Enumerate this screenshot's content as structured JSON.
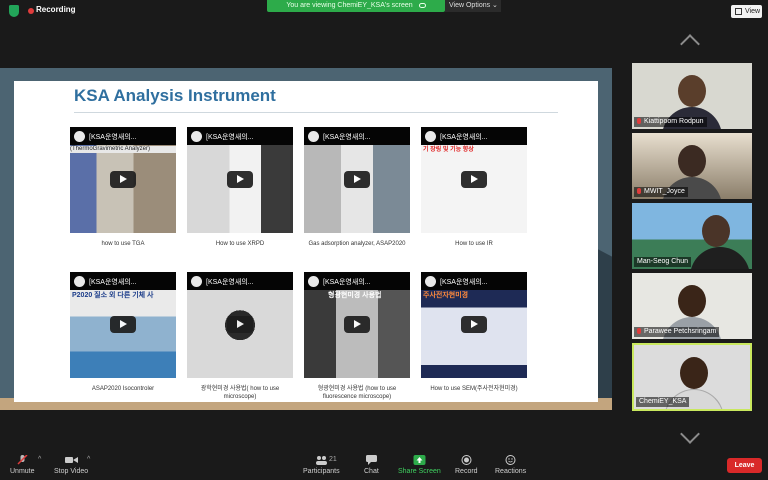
{
  "topbar": {
    "recording_label": "Recording",
    "viewing_banner": "You are viewing ChemiEY_KSA's screen",
    "view_options_label": "View Options ⌄",
    "view_button_label": "View"
  },
  "slide": {
    "title": "KSA Analysis Instrument",
    "videos": [
      {
        "thumb_title": "[KSA운영새의...",
        "overlay": "(ThermoGravimetric Analyzer)",
        "caption": "how to use TGA"
      },
      {
        "thumb_title": "[KSA운영새의...",
        "overlay": "",
        "caption": "How to use XRPD"
      },
      {
        "thumb_title": "[KSA운영새의...",
        "overlay": "",
        "caption": "Gas adsorption analyzer, ASAP2020"
      },
      {
        "thumb_title": "[KSA운영새의...",
        "overlay": "기 장링 및 기능 향상",
        "caption": "How to use IR"
      },
      {
        "thumb_title": "[KSA운영새의...",
        "overlay": "P2020 질소 외 다른 기체 사",
        "caption": "ASAP2020 Isocontroler"
      },
      {
        "thumb_title": "[KSA운영새의...",
        "overlay": "",
        "caption": "광학현미경 사용법( how to use microscope)"
      },
      {
        "thumb_title": "[KSA운영새의...",
        "overlay": "형광현미경 사용법",
        "caption": "형광현미경 사용법 (how to use fluorescence microscope)"
      },
      {
        "thumb_title": "[KSA운영새의...",
        "overlay": "주사전자현미경",
        "caption": "How to use SEM(주사전자현미경)"
      }
    ]
  },
  "participants": [
    {
      "name": "Kiattipoom Rodpun",
      "muted": true
    },
    {
      "name": "MWIT_Joyce",
      "muted": true
    },
    {
      "name": "Man-Seog Chun",
      "muted": false
    },
    {
      "name": "Parawee Petchsringam",
      "muted": true
    },
    {
      "name": "ChemiEY_KSA",
      "muted": false
    }
  ],
  "toolbar": {
    "unmute": "Unmute",
    "stop_video": "Stop Video",
    "participants": "Participants",
    "participants_count": "21",
    "chat": "Chat",
    "share_screen": "Share Screen",
    "record": "Record",
    "reactions": "Reactions",
    "leave": "Leave"
  },
  "colors": {
    "share_green": "#2dab4a",
    "leave_red": "#d92929",
    "active_speaker": "#c9e85e",
    "slide_title": "#2f6f9f"
  }
}
